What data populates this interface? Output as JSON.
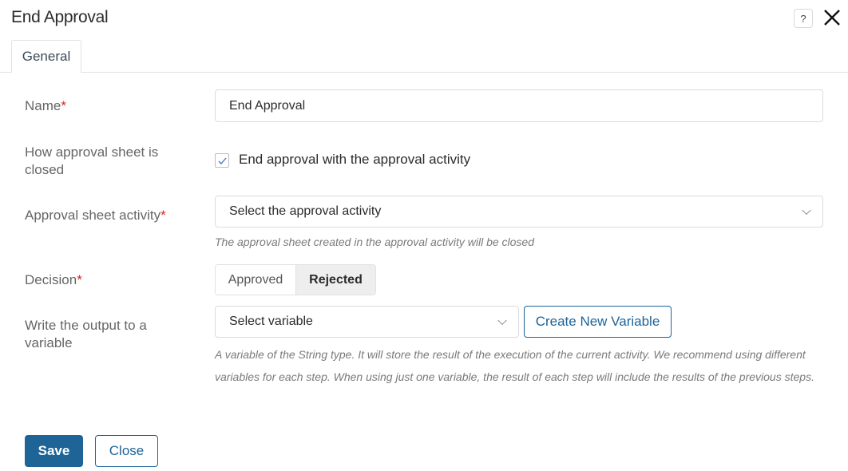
{
  "dialog": {
    "title": "End Approval",
    "help_icon": "help-question-icon",
    "close_icon": "close-x-icon"
  },
  "tabs": [
    {
      "label": "General",
      "active": true
    }
  ],
  "form": {
    "name": {
      "label": "Name",
      "required_mark": "*",
      "value": "End Approval"
    },
    "how_closed": {
      "label": "How approval sheet is closed",
      "checkbox_label": "End approval with the approval activity",
      "checked": true
    },
    "approval_activity": {
      "label": "Approval sheet activity",
      "required_mark": "*",
      "placeholder": "Select the approval activity",
      "hint": "The approval sheet created in the approval activity will be closed"
    },
    "decision": {
      "label": "Decision",
      "required_mark": "*",
      "options": [
        "Approved",
        "Rejected"
      ],
      "selected": "Rejected"
    },
    "output_variable": {
      "label": "Write the output to a variable",
      "placeholder": "Select variable",
      "create_button": "Create New Variable",
      "hint": "A variable of the String type. It will store the result of the execution of the current activity. We recommend using different variables for each step. When using just one variable, the result of each step will include the results of the previous steps."
    }
  },
  "footer": {
    "save_label": "Save",
    "close_label": "Close"
  },
  "colors": {
    "primary": "#1e6497",
    "required": "#e02020"
  }
}
